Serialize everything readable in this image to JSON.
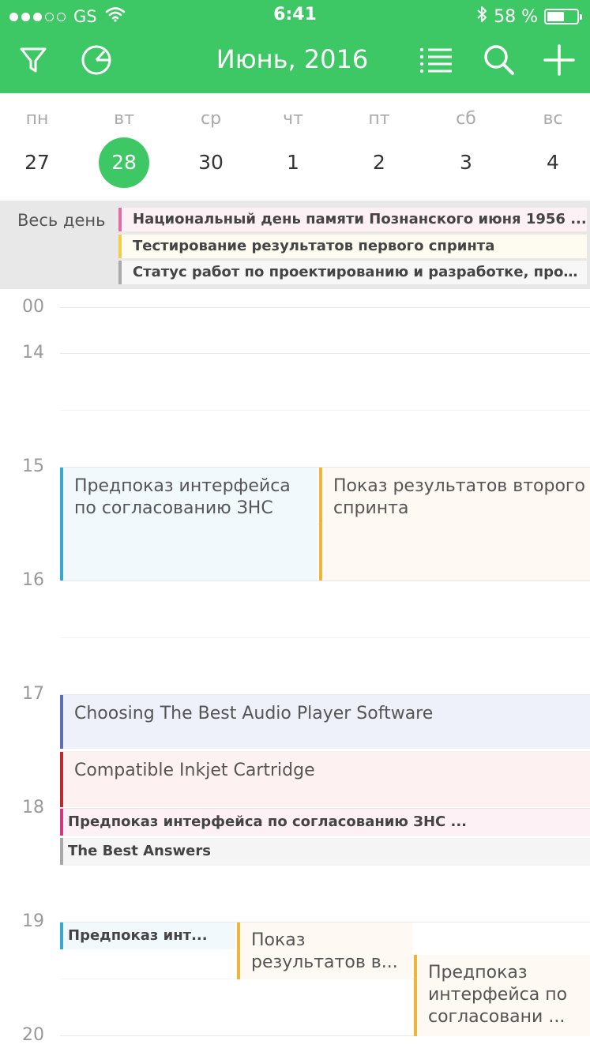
{
  "status_bar": {
    "carrier": "GS",
    "time": "6:41",
    "battery": "58 %",
    "battery_level": 0.58
  },
  "header": {
    "title": "Июнь, 2016",
    "icons": [
      "filter-icon",
      "pie-chart-icon",
      "list-icon",
      "search-icon",
      "plus-icon"
    ]
  },
  "week": {
    "days": [
      {
        "name": "пн",
        "num": "27"
      },
      {
        "name": "вт",
        "num": "28"
      },
      {
        "name": "ср",
        "num": "30"
      },
      {
        "name": "чт",
        "num": "1"
      },
      {
        "name": "пт",
        "num": "2"
      },
      {
        "name": "сб",
        "num": "3"
      },
      {
        "name": "вс",
        "num": "4"
      }
    ],
    "selected_index": 1
  },
  "all_day": {
    "label": "Весь день",
    "events": [
      {
        "title": "Национальный день памяти Познанского июня 1956 ...",
        "color": "#e66aa6",
        "bg": "#fdf1f6"
      },
      {
        "title": "Тестирование результатов первого спринта",
        "color": "#f2cd47",
        "bg": "#fefcf1"
      },
      {
        "title": "Статус работ по проектированию и разработке, прое...",
        "color": "#a9a9a9",
        "bg": "#f7f7f7"
      }
    ]
  },
  "timeline": {
    "hours": [
      "00",
      "14",
      "15",
      "16",
      "17",
      "18",
      "19",
      "20"
    ],
    "events": [
      {
        "title": "Предпоказ интерфейса по согласованию ЗНС",
        "color": "#3aa7d0",
        "bg": "#f2f9fd"
      },
      {
        "title": "Показ результатов второго спринта",
        "color": "#f0b43a",
        "bg": "#fef9f2"
      },
      {
        "title": "Choosing The Best Audio Player Software",
        "color": "#5b6fb8",
        "bg": "#eff1fa"
      },
      {
        "title": "Compatible Inkjet Cartridge",
        "color": "#c0282e",
        "bg": "#fdf2f1"
      },
      {
        "title": "Предпоказ интерфейса по согласованию ЗНС ...",
        "color": "#d6357f",
        "bg": "#fdf1f6"
      },
      {
        "title": "The Best Answers",
        "color": "#a9a9a9",
        "bg": "#f5f5f5"
      },
      {
        "title": "Предпоказ инт...",
        "color": "#3aa7d0",
        "bg": "#f2f9fd"
      },
      {
        "title": "Показ результатов в...",
        "color": "#f0b43a",
        "bg": "#fef9f2"
      },
      {
        "title": "Предпоказ интерфейса по согласовани ...",
        "color": "#f0b43a",
        "bg": "#fef9f2"
      }
    ]
  }
}
